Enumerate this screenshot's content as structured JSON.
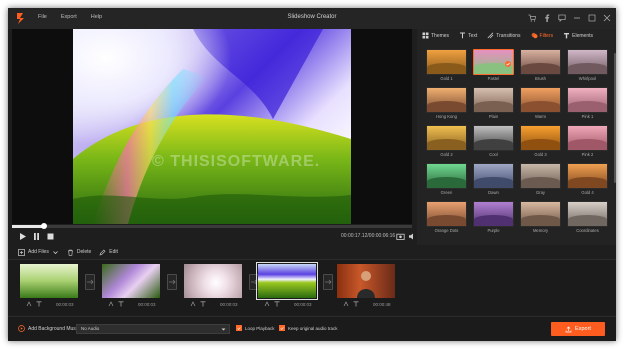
{
  "app": {
    "title": "Slideshow Creator",
    "menu": [
      "File",
      "Export",
      "Help"
    ],
    "accent": "#ff5d1f"
  },
  "preview": {
    "watermark": "© THISISOFTWARE.",
    "timecode": "00:00:17.12/00:00:06:16",
    "progress_fraction": 0.08
  },
  "panel": {
    "tabs": [
      {
        "label": "Themes",
        "icon": "themes-icon"
      },
      {
        "label": "Text",
        "icon": "text-icon"
      },
      {
        "label": "Transitions",
        "icon": "transitions-icon"
      },
      {
        "label": "Filters",
        "icon": "filters-icon"
      },
      {
        "label": "Elements",
        "icon": "elements-icon"
      }
    ],
    "active_tab": "Filters",
    "filters": [
      {
        "label": "Gold 1",
        "c1": "#f0a040",
        "c2": "#8a5a1a"
      },
      {
        "label": "Pastel",
        "c1": "#e890c0",
        "c2": "#8ac080"
      },
      {
        "label": "Brush",
        "c1": "#d8b0a0",
        "c2": "#6a4a40"
      },
      {
        "label": "Whirlpool",
        "c1": "#d0b8c8",
        "c2": "#705a60"
      },
      {
        "label": "Hong Kong",
        "c1": "#f0b070",
        "c2": "#7a4a30"
      },
      {
        "label": "Plain",
        "c1": "#d8c0b0",
        "c2": "#7a6050"
      },
      {
        "label": "Warm",
        "c1": "#f0a060",
        "c2": "#8a5030"
      },
      {
        "label": "Pink 1",
        "c1": "#f0b0c0",
        "c2": "#9a6070"
      },
      {
        "label": "Gold 2",
        "c1": "#f0c050",
        "c2": "#8a6020"
      },
      {
        "label": "Cool",
        "c1": "#c0c0c0",
        "c2": "#404040"
      },
      {
        "label": "Gold 3",
        "c1": "#f8a030",
        "c2": "#905010"
      },
      {
        "label": "Pink 2",
        "c1": "#f0a8b8",
        "c2": "#a05868"
      },
      {
        "label": "Green",
        "c1": "#70d890",
        "c2": "#2a6a3a"
      },
      {
        "label": "Dawn",
        "c1": "#a0a8c8",
        "c2": "#404a6a"
      },
      {
        "label": "Gray",
        "c1": "#c8b8a8",
        "c2": "#6a5a50"
      },
      {
        "label": "Gold 4",
        "c1": "#f0a050",
        "c2": "#804820"
      },
      {
        "label": "Orange Dots",
        "c1": "#e8a070",
        "c2": "#7a4a30"
      },
      {
        "label": "Purple",
        "c1": "#b080d0",
        "c2": "#503070"
      },
      {
        "label": "Memory",
        "c1": "#d8b8a0",
        "c2": "#705848"
      },
      {
        "label": "Coordinates",
        "c1": "#d8d0c8",
        "c2": "#706860"
      },
      {
        "label": "",
        "c1": "#e8a080",
        "c2": "#805040"
      },
      {
        "label": "",
        "c1": "#c0a0c8",
        "c2": "#604860"
      },
      {
        "label": "",
        "c1": "#e0b090",
        "c2": "#7a5040"
      },
      {
        "label": "",
        "c1": "#d0c0d0",
        "c2": "#6a5a6a"
      }
    ],
    "selected_filter": "Pastel"
  },
  "edit": {
    "add_files": "Add Files",
    "delete": "Delete",
    "edit": "Edit"
  },
  "timeline": {
    "clips": [
      {
        "duration": "00:00:03",
        "theme": "grass-cup"
      },
      {
        "duration": "00:00:03",
        "theme": "flowers"
      },
      {
        "duration": "00:00:03",
        "theme": "dandelion"
      },
      {
        "duration": "00:00:03",
        "theme": "hill",
        "selected": true
      },
      {
        "duration": "00:00:48",
        "theme": "person"
      }
    ]
  },
  "bottom": {
    "music_label": "Add Background Music:",
    "audio_value": "No Audio",
    "loop_label": "Loop Playback",
    "keep_audio_label": "Keep original audio track",
    "export_label": "Export"
  }
}
